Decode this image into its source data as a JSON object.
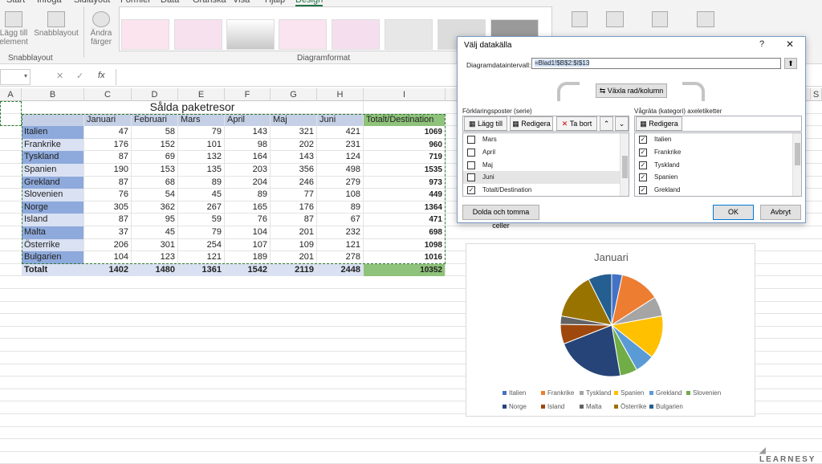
{
  "ribbon": {
    "tabs": [
      "Start",
      "Infoga",
      "Sidlayout",
      "Formler",
      "Data",
      "Granska",
      "Visa",
      "Hjälp",
      "Design"
    ],
    "add_element_label": "Lägg till element",
    "quick_layout_label": "Snabblayout",
    "change_colors_label": "Ändra färger",
    "group_quicklayout": "Snabblayout",
    "group_chartformat": "Diagramformat"
  },
  "formula_bar": {
    "cell_ref": "",
    "fx": "fx"
  },
  "columns": [
    "A",
    "B",
    "C",
    "D",
    "E",
    "F",
    "G",
    "H",
    "I",
    "J",
    "K",
    "L",
    "M",
    "N",
    "O",
    "P",
    "Q",
    "R",
    "S"
  ],
  "sheet": {
    "title": "Sålda paketresor",
    "headers": [
      "Januari",
      "Februari",
      "Mars",
      "April",
      "Maj",
      "Juni",
      "Totalt/Destination"
    ],
    "rows": [
      {
        "name": "Italien",
        "values": [
          "47",
          "58",
          "79",
          "143",
          "321",
          "421"
        ],
        "total": "1069"
      },
      {
        "name": "Frankrike",
        "values": [
          "176",
          "152",
          "101",
          "98",
          "202",
          "231"
        ],
        "total": "960"
      },
      {
        "name": "Tyskland",
        "values": [
          "87",
          "69",
          "132",
          "164",
          "143",
          "124"
        ],
        "total": "719"
      },
      {
        "name": "Spanien",
        "values": [
          "190",
          "153",
          "135",
          "203",
          "356",
          "498"
        ],
        "total": "1535"
      },
      {
        "name": "Grekland",
        "values": [
          "87",
          "68",
          "89",
          "204",
          "246",
          "279"
        ],
        "total": "973"
      },
      {
        "name": "Slovenien",
        "values": [
          "76",
          "54",
          "45",
          "89",
          "77",
          "108"
        ],
        "total": "449"
      },
      {
        "name": "Norge",
        "values": [
          "305",
          "362",
          "267",
          "165",
          "176",
          "89"
        ],
        "total": "1364"
      },
      {
        "name": "Island",
        "values": [
          "87",
          "95",
          "59",
          "76",
          "87",
          "67"
        ],
        "total": "471"
      },
      {
        "name": "Malta",
        "values": [
          "37",
          "45",
          "79",
          "104",
          "201",
          "232"
        ],
        "total": "698"
      },
      {
        "name": "Österrike",
        "values": [
          "206",
          "301",
          "254",
          "107",
          "109",
          "121"
        ],
        "total": "1098"
      },
      {
        "name": "Bulgarien",
        "values": [
          "104",
          "123",
          "121",
          "189",
          "201",
          "278"
        ],
        "total": "1016"
      }
    ],
    "total_row": {
      "name": "Totalt",
      "values": [
        "1402",
        "1480",
        "1361",
        "1542",
        "2119",
        "2448"
      ],
      "total": "10352"
    }
  },
  "dialog": {
    "title": "Välj datakälla",
    "help": "?",
    "close": "✕",
    "range_label": "Diagramdataintervall:",
    "range_value": "=Blad1!$B$2:$I$13",
    "switch_label": "Växla rad/kolumn",
    "series_header": "Förklaringsposter (serie)",
    "add_label": "Lägg till",
    "edit_label": "Redigera",
    "remove_label": "Ta bort",
    "series_items": [
      {
        "label": "Mars",
        "checked": false
      },
      {
        "label": "April",
        "checked": false
      },
      {
        "label": "Maj",
        "checked": false
      },
      {
        "label": "Juni",
        "checked": false
      },
      {
        "label": "Totalt/Destination",
        "checked": true
      }
    ],
    "axis_header": "Vågräta (kategori) axeletiketter",
    "axis_edit_label": "Redigera",
    "axis_items": [
      {
        "label": "Italien",
        "checked": true
      },
      {
        "label": "Frankrike",
        "checked": true
      },
      {
        "label": "Tyskland",
        "checked": true
      },
      {
        "label": "Spanien",
        "checked": true
      },
      {
        "label": "Grekland",
        "checked": true
      }
    ],
    "hidden_cells_label": "Dolda och tomma celler",
    "ok_label": "OK",
    "cancel_label": "Avbryt"
  },
  "chart_data": {
    "type": "pie",
    "title": "Januari",
    "categories": [
      "Italien",
      "Frankrike",
      "Tyskland",
      "Spanien",
      "Grekland",
      "Slovenien",
      "Norge",
      "Island",
      "Malta",
      "Österrike",
      "Bulgarien"
    ],
    "values": [
      47,
      176,
      87,
      190,
      87,
      76,
      305,
      87,
      37,
      206,
      104
    ],
    "colors": [
      "#4472c4",
      "#ed7d31",
      "#a5a5a5",
      "#ffc000",
      "#5b9bd5",
      "#70ad47",
      "#264478",
      "#9e480e",
      "#636363",
      "#997300",
      "#255e91"
    ],
    "legend_position": "bottom"
  },
  "watermark": "LEARNESY"
}
